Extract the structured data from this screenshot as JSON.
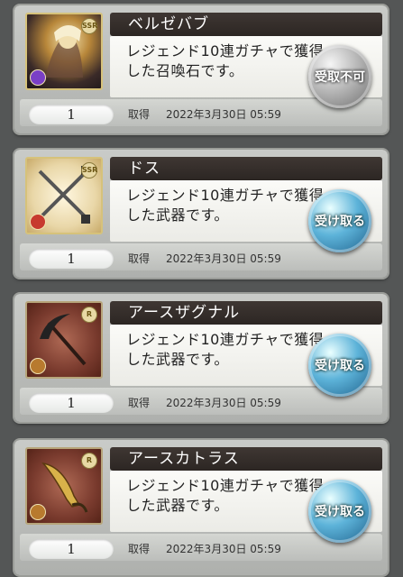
{
  "items": [
    {
      "name": "ベルゼバブ",
      "description": "レジェンド10連ガチャで獲得した召喚石です。",
      "quantity": "1",
      "acquired_label": "取得",
      "acquired_date": "2022年3月30日 05:59",
      "button_label": "受取不可",
      "button_state": "disabled",
      "rarity": "SSR",
      "element_color": "#7a3fc6",
      "thumb_icon": "summon-portrait-icon"
    },
    {
      "name": "ドス",
      "description": "レジェンド10連ガチャで獲得した武器です。",
      "quantity": "1",
      "acquired_label": "取得",
      "acquired_date": "2022年3月30日 05:59",
      "button_label": "受け取る",
      "button_state": "active",
      "rarity": "SSR",
      "element_color": "#c73a2f",
      "thumb_icon": "crossed-blades-icon"
    },
    {
      "name": "アースザグナル",
      "description": "レジェンド10連ガチャで獲得した武器です。",
      "quantity": "1",
      "acquired_label": "取得",
      "acquired_date": "2022年3月30日 05:59",
      "button_label": "受け取る",
      "button_state": "active",
      "rarity": "R",
      "element_color": "#b87a2e",
      "thumb_icon": "pickaxe-icon"
    },
    {
      "name": "アースカトラス",
      "description": "レジェンド10連ガチャで獲得した武器です。",
      "quantity": "1",
      "acquired_label": "取得",
      "acquired_date": "2022年3月30日 05:59",
      "button_label": "受け取る",
      "button_state": "active",
      "rarity": "R",
      "element_color": "#b87a2e",
      "thumb_icon": "cutlass-icon"
    }
  ]
}
